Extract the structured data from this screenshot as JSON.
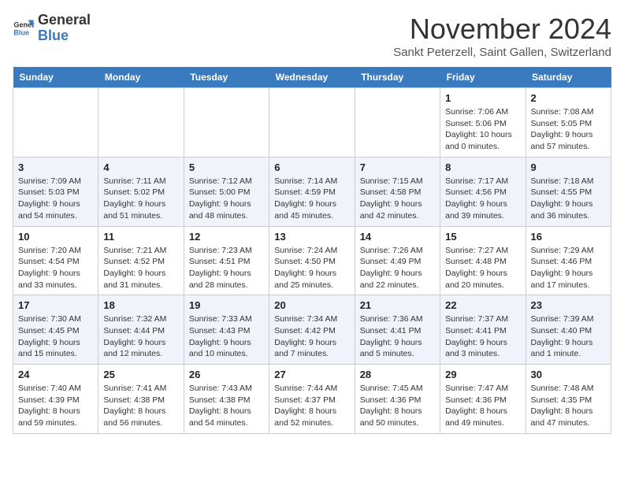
{
  "header": {
    "logo_line1": "General",
    "logo_line2": "Blue",
    "month_year": "November 2024",
    "location": "Sankt Peterzell, Saint Gallen, Switzerland"
  },
  "weekdays": [
    "Sunday",
    "Monday",
    "Tuesday",
    "Wednesday",
    "Thursday",
    "Friday",
    "Saturday"
  ],
  "weeks": [
    [
      {
        "day": "",
        "sunrise": "",
        "sunset": "",
        "daylight": ""
      },
      {
        "day": "",
        "sunrise": "",
        "sunset": "",
        "daylight": ""
      },
      {
        "day": "",
        "sunrise": "",
        "sunset": "",
        "daylight": ""
      },
      {
        "day": "",
        "sunrise": "",
        "sunset": "",
        "daylight": ""
      },
      {
        "day": "",
        "sunrise": "",
        "sunset": "",
        "daylight": ""
      },
      {
        "day": "1",
        "sunrise": "Sunrise: 7:06 AM",
        "sunset": "Sunset: 5:06 PM",
        "daylight": "Daylight: 10 hours and 0 minutes."
      },
      {
        "day": "2",
        "sunrise": "Sunrise: 7:08 AM",
        "sunset": "Sunset: 5:05 PM",
        "daylight": "Daylight: 9 hours and 57 minutes."
      }
    ],
    [
      {
        "day": "3",
        "sunrise": "Sunrise: 7:09 AM",
        "sunset": "Sunset: 5:03 PM",
        "daylight": "Daylight: 9 hours and 54 minutes."
      },
      {
        "day": "4",
        "sunrise": "Sunrise: 7:11 AM",
        "sunset": "Sunset: 5:02 PM",
        "daylight": "Daylight: 9 hours and 51 minutes."
      },
      {
        "day": "5",
        "sunrise": "Sunrise: 7:12 AM",
        "sunset": "Sunset: 5:00 PM",
        "daylight": "Daylight: 9 hours and 48 minutes."
      },
      {
        "day": "6",
        "sunrise": "Sunrise: 7:14 AM",
        "sunset": "Sunset: 4:59 PM",
        "daylight": "Daylight: 9 hours and 45 minutes."
      },
      {
        "day": "7",
        "sunrise": "Sunrise: 7:15 AM",
        "sunset": "Sunset: 4:58 PM",
        "daylight": "Daylight: 9 hours and 42 minutes."
      },
      {
        "day": "8",
        "sunrise": "Sunrise: 7:17 AM",
        "sunset": "Sunset: 4:56 PM",
        "daylight": "Daylight: 9 hours and 39 minutes."
      },
      {
        "day": "9",
        "sunrise": "Sunrise: 7:18 AM",
        "sunset": "Sunset: 4:55 PM",
        "daylight": "Daylight: 9 hours and 36 minutes."
      }
    ],
    [
      {
        "day": "10",
        "sunrise": "Sunrise: 7:20 AM",
        "sunset": "Sunset: 4:54 PM",
        "daylight": "Daylight: 9 hours and 33 minutes."
      },
      {
        "day": "11",
        "sunrise": "Sunrise: 7:21 AM",
        "sunset": "Sunset: 4:52 PM",
        "daylight": "Daylight: 9 hours and 31 minutes."
      },
      {
        "day": "12",
        "sunrise": "Sunrise: 7:23 AM",
        "sunset": "Sunset: 4:51 PM",
        "daylight": "Daylight: 9 hours and 28 minutes."
      },
      {
        "day": "13",
        "sunrise": "Sunrise: 7:24 AM",
        "sunset": "Sunset: 4:50 PM",
        "daylight": "Daylight: 9 hours and 25 minutes."
      },
      {
        "day": "14",
        "sunrise": "Sunrise: 7:26 AM",
        "sunset": "Sunset: 4:49 PM",
        "daylight": "Daylight: 9 hours and 22 minutes."
      },
      {
        "day": "15",
        "sunrise": "Sunrise: 7:27 AM",
        "sunset": "Sunset: 4:48 PM",
        "daylight": "Daylight: 9 hours and 20 minutes."
      },
      {
        "day": "16",
        "sunrise": "Sunrise: 7:29 AM",
        "sunset": "Sunset: 4:46 PM",
        "daylight": "Daylight: 9 hours and 17 minutes."
      }
    ],
    [
      {
        "day": "17",
        "sunrise": "Sunrise: 7:30 AM",
        "sunset": "Sunset: 4:45 PM",
        "daylight": "Daylight: 9 hours and 15 minutes."
      },
      {
        "day": "18",
        "sunrise": "Sunrise: 7:32 AM",
        "sunset": "Sunset: 4:44 PM",
        "daylight": "Daylight: 9 hours and 12 minutes."
      },
      {
        "day": "19",
        "sunrise": "Sunrise: 7:33 AM",
        "sunset": "Sunset: 4:43 PM",
        "daylight": "Daylight: 9 hours and 10 minutes."
      },
      {
        "day": "20",
        "sunrise": "Sunrise: 7:34 AM",
        "sunset": "Sunset: 4:42 PM",
        "daylight": "Daylight: 9 hours and 7 minutes."
      },
      {
        "day": "21",
        "sunrise": "Sunrise: 7:36 AM",
        "sunset": "Sunset: 4:41 PM",
        "daylight": "Daylight: 9 hours and 5 minutes."
      },
      {
        "day": "22",
        "sunrise": "Sunrise: 7:37 AM",
        "sunset": "Sunset: 4:41 PM",
        "daylight": "Daylight: 9 hours and 3 minutes."
      },
      {
        "day": "23",
        "sunrise": "Sunrise: 7:39 AM",
        "sunset": "Sunset: 4:40 PM",
        "daylight": "Daylight: 9 hours and 1 minute."
      }
    ],
    [
      {
        "day": "24",
        "sunrise": "Sunrise: 7:40 AM",
        "sunset": "Sunset: 4:39 PM",
        "daylight": "Daylight: 8 hours and 59 minutes."
      },
      {
        "day": "25",
        "sunrise": "Sunrise: 7:41 AM",
        "sunset": "Sunset: 4:38 PM",
        "daylight": "Daylight: 8 hours and 56 minutes."
      },
      {
        "day": "26",
        "sunrise": "Sunrise: 7:43 AM",
        "sunset": "Sunset: 4:38 PM",
        "daylight": "Daylight: 8 hours and 54 minutes."
      },
      {
        "day": "27",
        "sunrise": "Sunrise: 7:44 AM",
        "sunset": "Sunset: 4:37 PM",
        "daylight": "Daylight: 8 hours and 52 minutes."
      },
      {
        "day": "28",
        "sunrise": "Sunrise: 7:45 AM",
        "sunset": "Sunset: 4:36 PM",
        "daylight": "Daylight: 8 hours and 50 minutes."
      },
      {
        "day": "29",
        "sunrise": "Sunrise: 7:47 AM",
        "sunset": "Sunset: 4:36 PM",
        "daylight": "Daylight: 8 hours and 49 minutes."
      },
      {
        "day": "30",
        "sunrise": "Sunrise: 7:48 AM",
        "sunset": "Sunset: 4:35 PM",
        "daylight": "Daylight: 8 hours and 47 minutes."
      }
    ]
  ]
}
